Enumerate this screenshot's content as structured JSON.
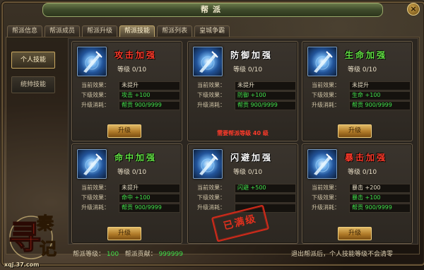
{
  "window": {
    "title": "帮派",
    "close_label": "×"
  },
  "tabs": [
    {
      "label": "帮派信息",
      "active": false
    },
    {
      "label": "帮派成员",
      "active": false
    },
    {
      "label": "帮派升级",
      "active": false
    },
    {
      "label": "帮派技能",
      "active": true
    },
    {
      "label": "帮派列表",
      "active": false
    },
    {
      "label": "皇城争霸",
      "active": false
    }
  ],
  "sidebar": [
    {
      "label": "个人技能",
      "active": true
    },
    {
      "label": "统帅技能",
      "active": false
    }
  ],
  "labels": {
    "current": "当前效果：",
    "next": "下级效果：",
    "cost": "升级消耗：",
    "upgrade": "升级"
  },
  "skills": [
    {
      "name": "攻击加强",
      "name_color": "red",
      "level": "等级 0/10",
      "current": "未提升",
      "next": "攻击 +100",
      "cost": "帮贡 900/9999",
      "action": "upgrade"
    },
    {
      "name": "防御加强",
      "name_color": "white",
      "level": "等级 0/10",
      "current": "未提升",
      "next": "防御 +100",
      "cost": "帮贡 900/9999",
      "action": "notice",
      "notice": "需要帮派等级 40 级"
    },
    {
      "name": "生命加强",
      "name_color": "green",
      "level": "等级 0/10",
      "current": "未提升",
      "next": "生命 +100",
      "cost": "帮贡 900/9999",
      "action": "upgrade"
    },
    {
      "name": "命中加强",
      "name_color": "green",
      "level": "等级 0/10",
      "current": "未提升",
      "next": "命中 +100",
      "cost": "帮贡 900/9999",
      "action": "upgrade"
    },
    {
      "name": "闪避加强",
      "name_color": "white",
      "level": "等级 0/10",
      "current": "闪避 +500",
      "next": "",
      "cost": "",
      "action": "maxed",
      "stamp": "已满级"
    },
    {
      "name": "暴击加强",
      "name_color": "red",
      "level": "等级 0/10",
      "current": "暴击 +200",
      "next": "暴击 +100",
      "cost": "帮贡 900/9999",
      "action": "upgrade"
    }
  ],
  "footer": {
    "level_label": "帮派等级：",
    "level_value": "100",
    "contrib_label": "帮派贡献：",
    "contrib_value": "999999",
    "note": "退出帮派后，个人技能等级不会清零"
  },
  "logo": {
    "url": "xqj.37.com"
  },
  "colors": {
    "red": "#ff3a2a",
    "green": "#3fe04a",
    "gold": "#c9a860"
  }
}
